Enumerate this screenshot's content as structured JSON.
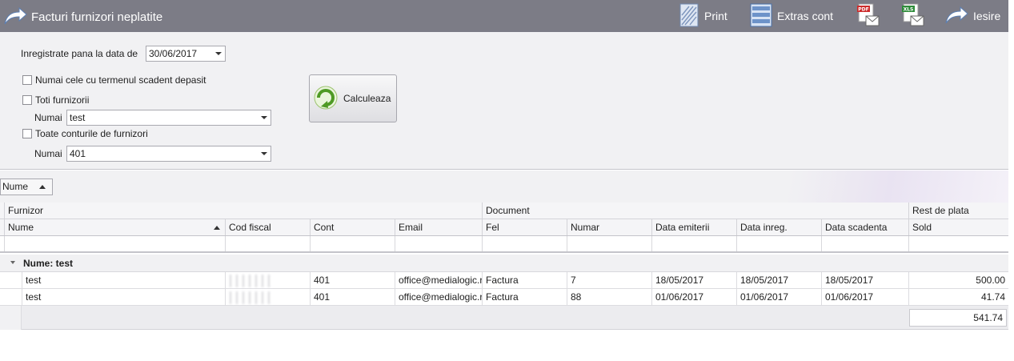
{
  "toolbar": {
    "title": "Facturi furnizori neplatite",
    "print": "Print",
    "extras": "Extras cont",
    "pdf_tag": "PDF",
    "xls_tag": "XLS",
    "exit": "Iesire"
  },
  "filters": {
    "date_label": "Inregistrate pana la data de",
    "date_value": "30/06/2017",
    "overdue_label": "Numai cele cu termenul scadent depasit",
    "overdue_checked": false,
    "all_suppliers_label": "Toti furnizorii",
    "all_suppliers_checked": false,
    "only_label_1": "Numai",
    "supplier_value": "test",
    "all_accounts_label": "Toate conturile de furnizori",
    "all_accounts_checked": false,
    "only_label_2": "Numai",
    "account_value": "401",
    "calc_button": "Calculeaza"
  },
  "groupby": {
    "chip": "Nume"
  },
  "grid": {
    "bands": {
      "furnizor": "Furnizor",
      "document": "Document",
      "rest": "Rest de plata"
    },
    "columns": {
      "nume": "Nume",
      "cod_fiscal": "Cod fiscal",
      "cont": "Cont",
      "email": "Email",
      "fel": "Fel",
      "numar": "Numar",
      "data_emiterii": "Data emiterii",
      "data_inreg": "Data inreg.",
      "data_scadenta": "Data scadenta",
      "sold": "Sold"
    },
    "group_title": "Nume: test",
    "rows": [
      {
        "nume": "test",
        "cont": "401",
        "email": "office@medialogic.ro",
        "fel": "Factura",
        "numar": "7",
        "data_emiterii": "18/05/2017",
        "data_inreg": "18/05/2017",
        "data_scadenta": "18/05/2017",
        "sold": "500.00"
      },
      {
        "nume": "test",
        "cont": "401",
        "email": "office@medialogic.ro",
        "fel": "Factura",
        "numar": "88",
        "data_emiterii": "01/06/2017",
        "data_inreg": "01/06/2017",
        "data_scadenta": "01/06/2017",
        "sold": "41.74"
      }
    ],
    "total": "541.74"
  },
  "colors": {
    "toolbar_bg": "#7c7c86",
    "panel_bg": "#f1f1f3",
    "refresh_green": "#5aa02c",
    "pdf_red": "#cc2b2b",
    "xls_green": "#2e8b3a"
  }
}
